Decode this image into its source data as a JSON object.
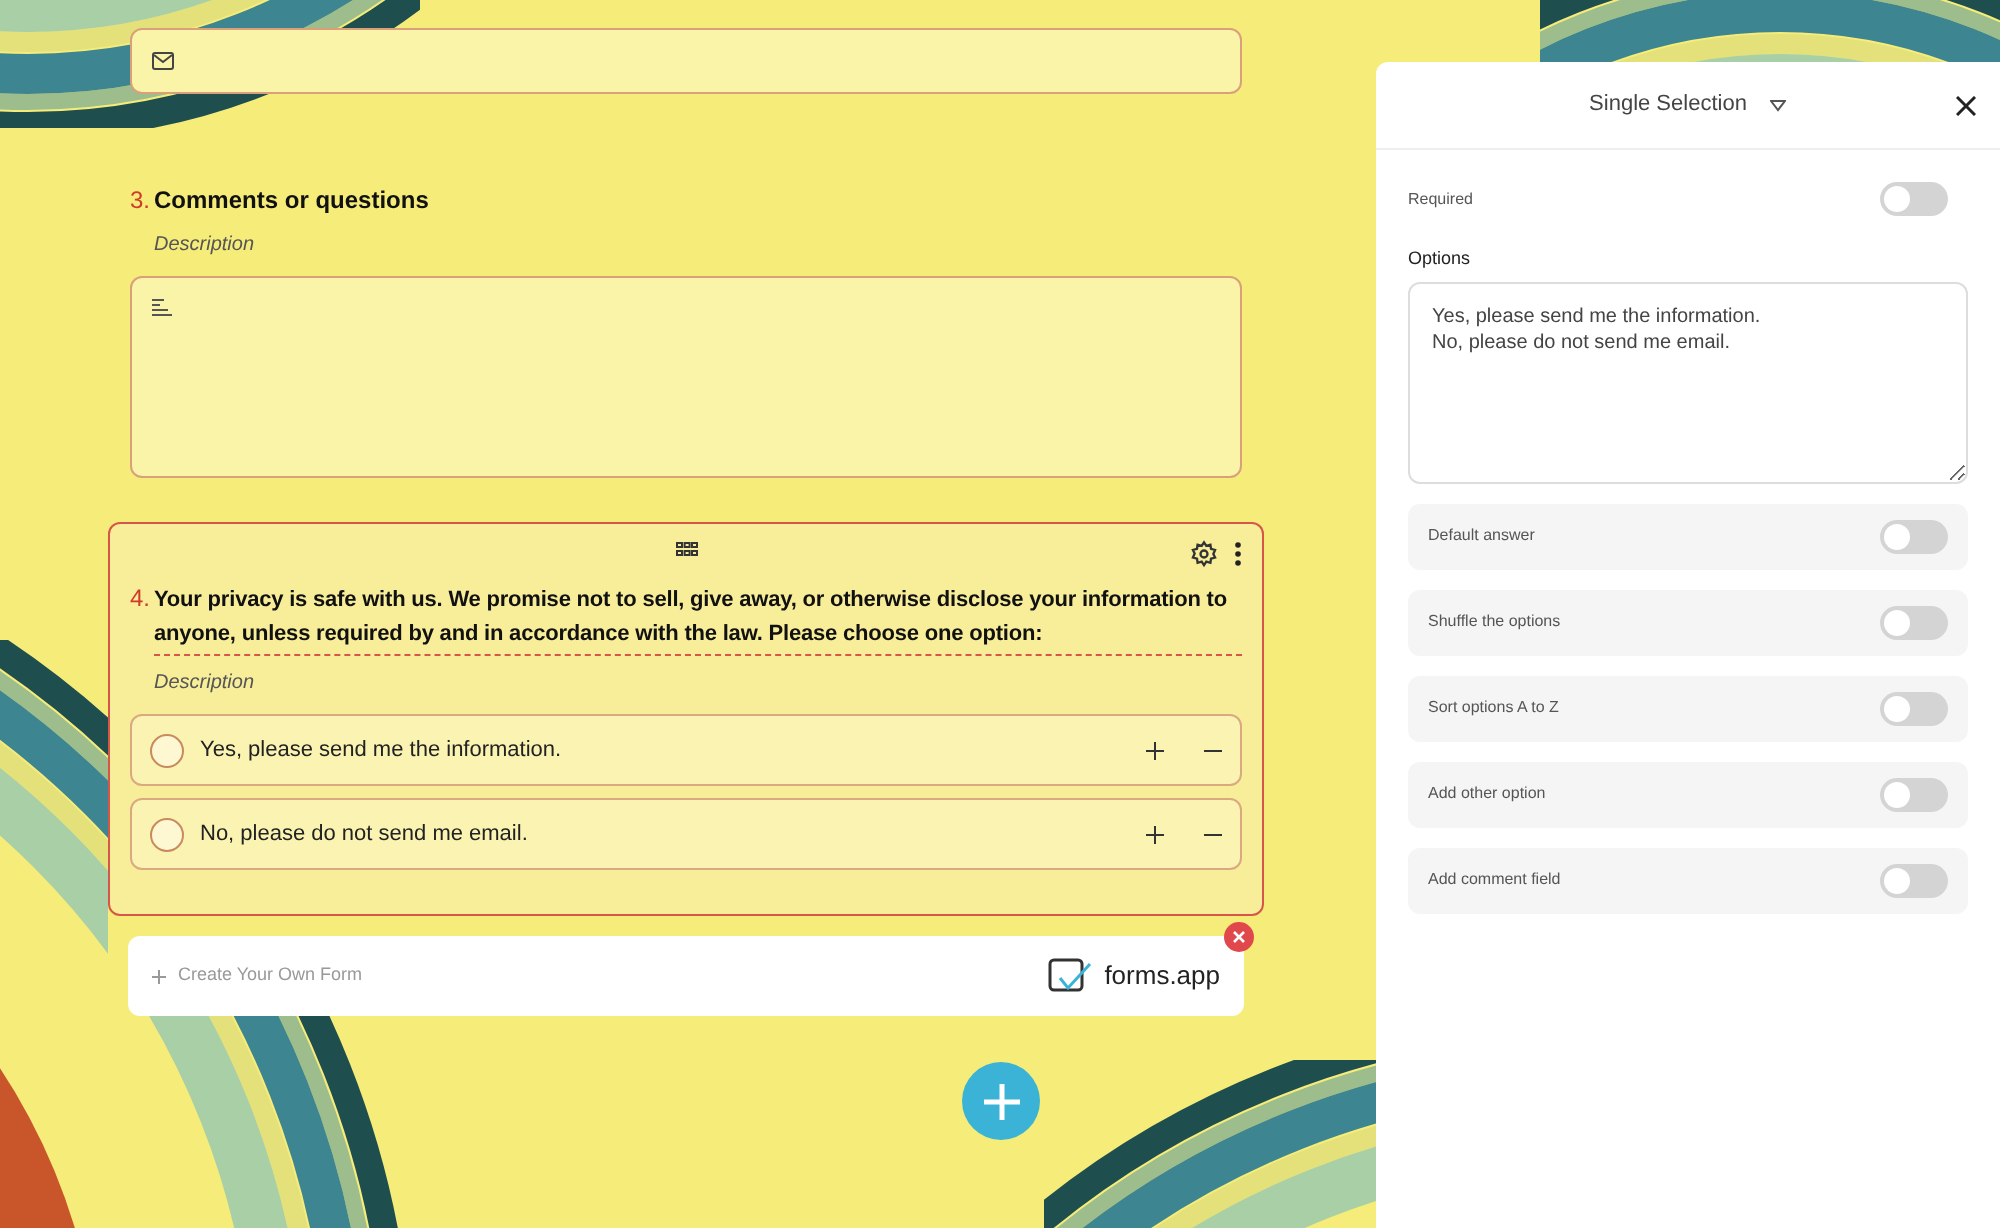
{
  "question_3": {
    "number": "3.",
    "title": "Comments or questions",
    "description": "Description"
  },
  "question_4": {
    "number": "4.",
    "title": "Your privacy is safe with us. We promise not to sell, give away, or otherwise disclose your information to anyone, unless required by and in accordance with the law. Please choose one option:",
    "description": "Description",
    "options": [
      {
        "label": "Yes, please send me the information.",
        "selected": false
      },
      {
        "label": "No, please do not send me email.",
        "selected": false
      }
    ]
  },
  "banner": {
    "prompt": "Create Your Own Form",
    "logo": "forms.app"
  },
  "panel": {
    "title": "Single Selection",
    "required": {
      "label": "Required",
      "on": false
    },
    "options_label": "Options",
    "options_text": "Yes, please send me the information.\nNo, please do not send me email.",
    "settings": [
      {
        "label": "Default answer",
        "on": false
      },
      {
        "label": "Shuffle the options",
        "on": false
      },
      {
        "label": "Sort options A to Z",
        "on": false
      },
      {
        "label": "Add other option",
        "on": false
      },
      {
        "label": "Add comment field",
        "on": false
      }
    ]
  }
}
